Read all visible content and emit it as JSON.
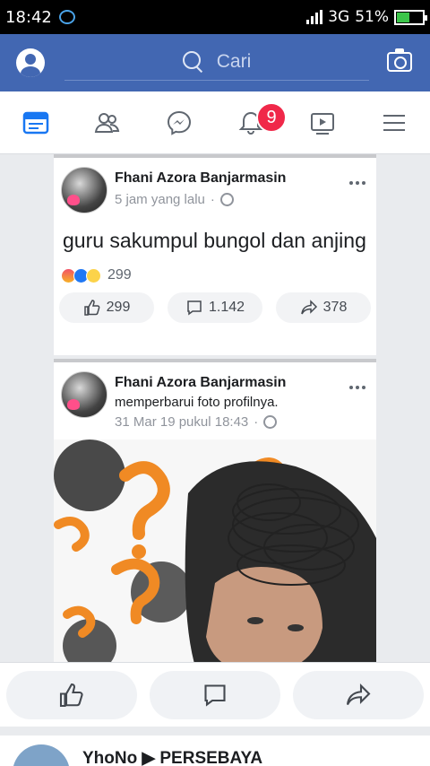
{
  "status_bar": {
    "time": "18:42",
    "network": "3G",
    "battery": "51%"
  },
  "search": {
    "placeholder": "Cari"
  },
  "nav": {
    "notification_count": "9"
  },
  "posts": [
    {
      "author": "Fhani Azora Banjarmasin",
      "time": "5 jam yang lalu",
      "separator": "·",
      "text": "guru sakumpul bungol dan anjing",
      "reaction_count": "299",
      "likes": "299",
      "comments": "1.142",
      "shares": "378"
    },
    {
      "author": "Fhani Azora Banjarmasin",
      "subtitle": "memperbarui foto profilnya.",
      "time": "31 Mar 19 pukul 18:43",
      "separator": "·"
    }
  ],
  "next_post": {
    "title": "YhoNo ▶ PERSEBAYA"
  },
  "colors": {
    "brand": "#4267b2",
    "badge": "#f02849"
  }
}
